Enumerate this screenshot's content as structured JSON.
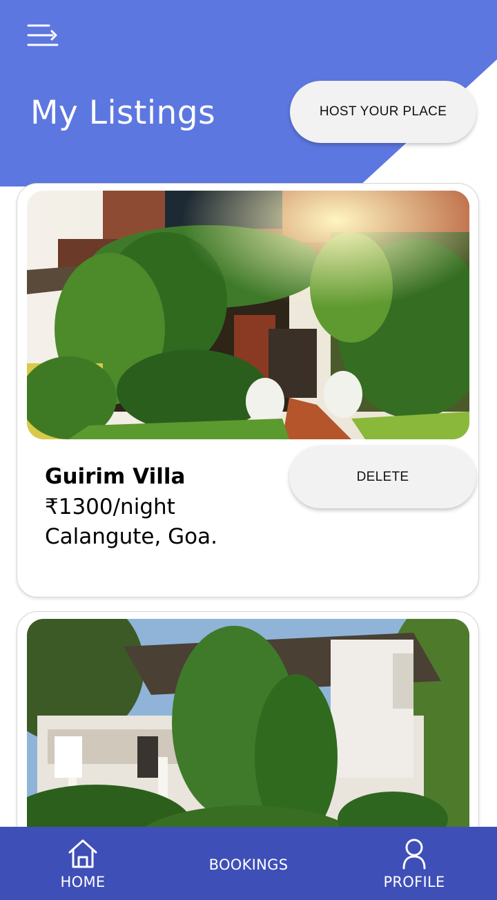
{
  "header": {
    "title": "My Listings",
    "host_button_label": "HOST YOUR PLACE",
    "accent_color": "#5d77e0"
  },
  "listings": [
    {
      "name": "Guirim Villa",
      "price": "₹1300/night",
      "location": "Calangute, Goa.",
      "delete_label": "DELETE"
    }
  ],
  "bottom_nav": {
    "color": "#3e4fb8",
    "items": [
      {
        "label": "HOME",
        "icon": "home-icon"
      },
      {
        "label": "BOOKINGS",
        "icon": ""
      },
      {
        "label": "PROFILE",
        "icon": "profile-icon"
      }
    ]
  },
  "icons": {
    "menu": "menu-icon"
  }
}
